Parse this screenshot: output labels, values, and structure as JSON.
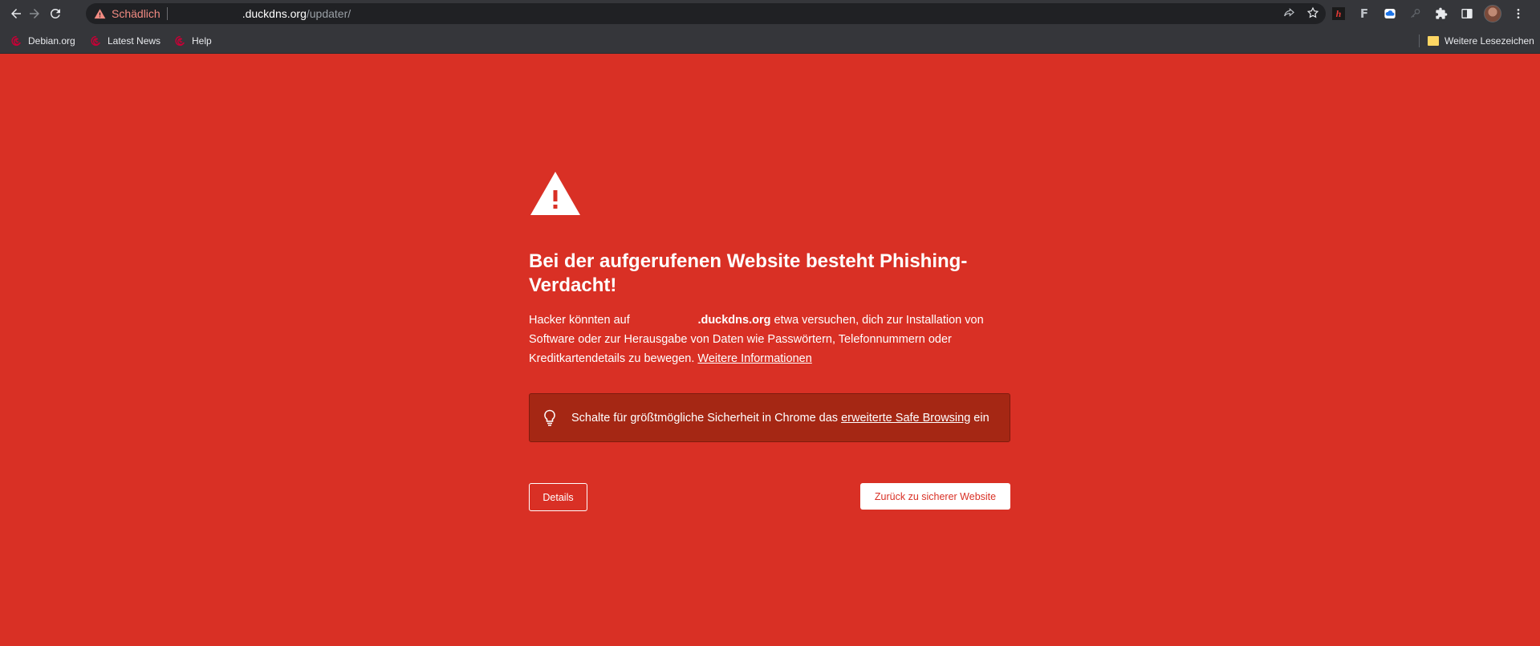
{
  "browser": {
    "security_state": "Schädlich",
    "url_host_redacted": ".duckdns.org",
    "url_path": "/updater/",
    "bookmarks": [
      {
        "label": "Debian.org",
        "icon": "debian-swirl-icon"
      },
      {
        "label": "Latest News",
        "icon": "debian-swirl-icon"
      },
      {
        "label": "Help",
        "icon": "debian-swirl-icon"
      }
    ],
    "other_bookmarks_label": "Weitere Lesezeichen",
    "extensions": [
      {
        "name": "h-extension-icon",
        "glyph": "h"
      },
      {
        "name": "f-extension-icon",
        "glyph": "F"
      },
      {
        "name": "cloud-extension-icon"
      },
      {
        "name": "key-extension-icon"
      },
      {
        "name": "puzzle-extensions-icon"
      },
      {
        "name": "side-panel-icon"
      },
      {
        "name": "profile-avatar"
      },
      {
        "name": "menu-kebab-icon"
      }
    ]
  },
  "interstitial": {
    "title": "Bei der aufgerufenen Website besteht Phishing-Verdacht!",
    "body_prefix": "Hacker könnten auf ",
    "body_domain": ".duckdns.org",
    "body_middle": " etwa versuchen, dich zur Installation von Software oder zur Herausgabe von Daten wie Passwörtern, Telefonnummern oder Kreditkartendetails zu bewegen. ",
    "body_link": "Weitere Informationen",
    "safe_browsing_prefix": "Schalte für größtmögliche Sicherheit in Chrome das ",
    "safe_browsing_link": "erweiterte Safe Browsing",
    "safe_browsing_suffix": " ein",
    "details_button": "Details",
    "back_button": "Zurück zu sicherer Website"
  },
  "colors": {
    "danger_red": "#d93025",
    "dark_red_box": "#a52714",
    "toolbar": "#35363a",
    "omnibox": "#202124"
  }
}
